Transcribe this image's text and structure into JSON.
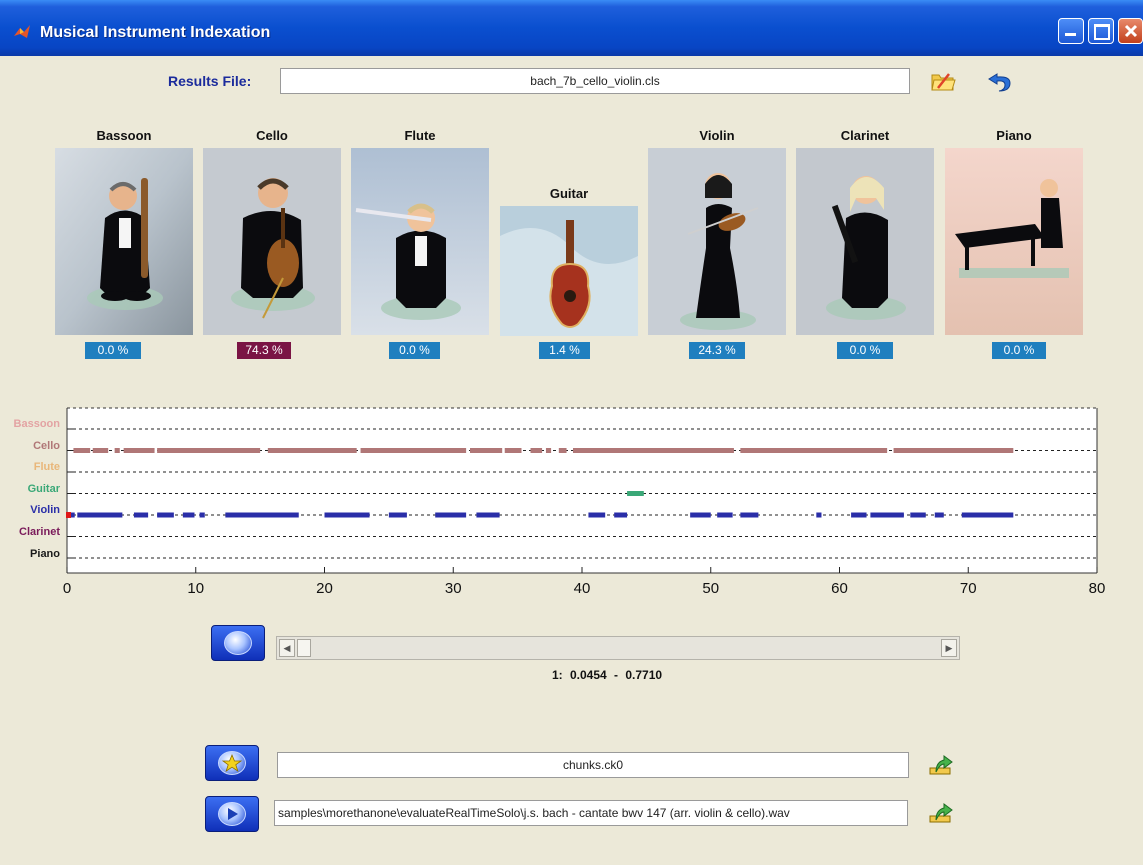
{
  "window": {
    "title": "Musical Instrument Indexation"
  },
  "results_file": {
    "label": "Results File:",
    "value": "bach_7b_cello_violin.cls"
  },
  "instruments": [
    {
      "name": "Bassoon",
      "percent": "0.0 %",
      "badge_color": "#1f7fbf"
    },
    {
      "name": "Cello",
      "percent": "74.3 %",
      "badge_color": "#7a1444"
    },
    {
      "name": "Flute",
      "percent": "0.0 %",
      "badge_color": "#1f7fbf"
    },
    {
      "name": "Guitar",
      "percent": "1.4 %",
      "badge_color": "#1f7fbf"
    },
    {
      "name": "Violin",
      "percent": "24.3 %",
      "badge_color": "#1f7fbf"
    },
    {
      "name": "Clarinet",
      "percent": "0.0 %",
      "badge_color": "#1f7fbf"
    },
    {
      "name": "Piano",
      "percent": "0.0 %",
      "badge_color": "#1f7fbf"
    }
  ],
  "chart_data": {
    "type": "timeline",
    "categories": [
      "Bassoon",
      "Cello",
      "Flute",
      "Guitar",
      "Violin",
      "Clarinet",
      "Piano"
    ],
    "category_colors": [
      "#e3a3a3",
      "#b07777",
      "#e9b77a",
      "#3aa877",
      "#2a2ea8",
      "#7a1a5a",
      "#1a1a1a"
    ],
    "x_ticks": [
      0,
      10,
      20,
      30,
      40,
      50,
      60,
      70,
      80
    ],
    "xlim": [
      0,
      80
    ],
    "grid": "dashed horizontal",
    "series": [
      {
        "name": "Cello",
        "segments": [
          [
            0.5,
            1.8
          ],
          [
            2,
            3.2
          ],
          [
            3.7,
            4.1
          ],
          [
            4.4,
            6.8
          ],
          [
            7,
            15
          ],
          [
            15.6,
            22.5
          ],
          [
            22.8,
            31
          ],
          [
            31.3,
            33.8
          ],
          [
            34,
            35.3
          ],
          [
            36,
            36.9
          ],
          [
            37.2,
            37.6
          ],
          [
            38.2,
            38.8
          ],
          [
            39.3,
            51.8
          ],
          [
            52.3,
            63.7
          ],
          [
            64.2,
            73.5
          ]
        ]
      },
      {
        "name": "Guitar",
        "segments": [
          [
            43.5,
            44.8
          ]
        ]
      },
      {
        "name": "Violin",
        "segments": [
          [
            0,
            0.6
          ],
          [
            0.8,
            4.3
          ],
          [
            5.2,
            6.3
          ],
          [
            7,
            8.3
          ],
          [
            9,
            9.9
          ],
          [
            10.3,
            10.7
          ],
          [
            12.3,
            18
          ],
          [
            20,
            23.5
          ],
          [
            25,
            26.4
          ],
          [
            28.6,
            31
          ],
          [
            31.8,
            33.6
          ],
          [
            40.5,
            41.8
          ],
          [
            42.5,
            43.5
          ],
          [
            48.4,
            50
          ],
          [
            50.5,
            51.7
          ],
          [
            52.3,
            53.7
          ],
          [
            58.2,
            58.6
          ],
          [
            60.9,
            62.1
          ],
          [
            62.4,
            65
          ],
          [
            65.5,
            66.7
          ],
          [
            67.4,
            68.1
          ],
          [
            69.5,
            73.5
          ]
        ]
      }
    ]
  },
  "zoom_range": {
    "text": "1:  0.0454  -  0.7710"
  },
  "chunks_file": {
    "value": "chunks.ck0"
  },
  "audio_file": {
    "value": "samples\\morethanone\\evaluateRealTimeSolo\\j.s. bach - cantate bwv 147 (arr. violin & cello).wav"
  }
}
